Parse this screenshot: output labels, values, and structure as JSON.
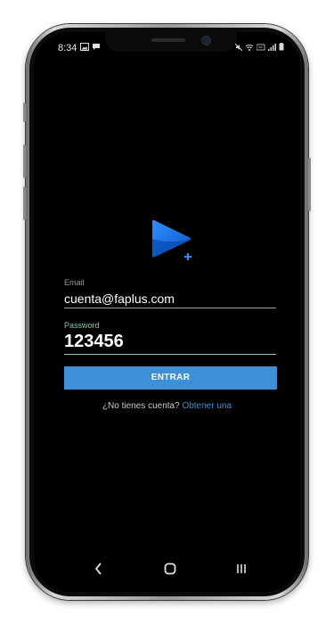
{
  "status_bar": {
    "time": "8:34",
    "icons": [
      "image-icon",
      "chat-icon",
      "mute-icon",
      "wifi-icon",
      "lte-icon",
      "signal-icon",
      "battery-icon"
    ]
  },
  "login": {
    "email_label": "Email",
    "email_value": "cuenta@faplus.com",
    "password_label": "Password",
    "password_value": "123456",
    "submit_label": "ENTRAR",
    "signup_prompt": "¿No tienes cuenta?",
    "signup_link": "Obtener una"
  },
  "colors": {
    "accent": "#3d8fd6",
    "focus_underline": "#8fc7a3",
    "background": "#000000"
  },
  "navbar": {
    "icons": [
      "back-icon",
      "home-icon",
      "recents-icon"
    ]
  }
}
